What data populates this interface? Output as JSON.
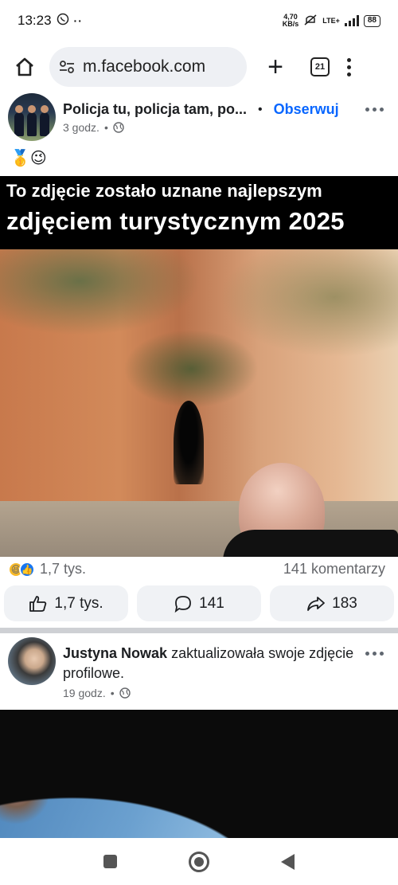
{
  "status_bar": {
    "time": "13:23",
    "net_speed_value": "4,70",
    "net_speed_unit": "KB/s",
    "network_type": "LTE+",
    "battery": "88"
  },
  "browser": {
    "url": "m.facebook.com",
    "tab_count": "21"
  },
  "post1": {
    "author": "Policja tu, policja tam, po...",
    "follow_label": "Obserwuj",
    "time": "3 godz.",
    "text_emojis": "🥇😉",
    "image_caption_line1": "To zdjęcie zostało uznane najlepszym",
    "image_caption_line2": "zdjęciem turystycznym 2025",
    "reaction_count": "1,7 tys.",
    "comments_count": "141 komentarzy",
    "actions": {
      "like": "1,7 tys.",
      "comment": "141",
      "share": "183"
    }
  },
  "post2": {
    "author": "Justyna Nowak",
    "action_text": "zaktualizowała swoje zdjęcie profilowe.",
    "time": "19 godz."
  },
  "colors": {
    "accent": "#0866ff",
    "secondary_text": "#65676b",
    "button_bg": "#f0f2f5"
  }
}
